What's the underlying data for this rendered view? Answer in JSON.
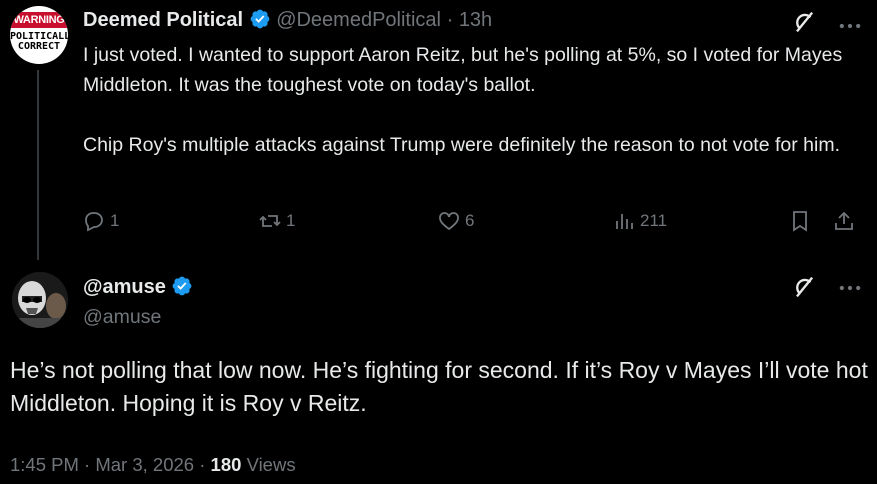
{
  "parent": {
    "avatar_text_top": "WARNING",
    "avatar_text_bottom": "POLITICALLY CORRECT",
    "display_name": "Deemed Political",
    "handle": "@DeemedPolitical",
    "separator": "·",
    "time": "13h",
    "text_p1": "I just voted. I wanted to support Aaron Reitz, but he's polling at 5%, so I voted for Mayes Middleton. It was the toughest vote on today's ballot.",
    "text_p2": "Chip Roy's multiple attacks against Trump were definitely the reason to not vote for him.",
    "replies": "1",
    "reposts": "1",
    "likes": "6",
    "views": "211"
  },
  "reply": {
    "display_name": "@amuse",
    "handle": "@amuse",
    "text": "He’s not polling that low now. He’s fighting for second. If it’s Roy v Mayes I’ll vote hot Middleton. Hoping it is Roy v Reitz.",
    "time": "1:45 PM",
    "date": "Mar 3, 2026",
    "separator": "·",
    "views_count": "180",
    "views_label": "Views"
  },
  "colors": {
    "background": "#000000",
    "text": "#e7e9ea",
    "muted": "#71767b",
    "verified": "#1d9bf0"
  }
}
